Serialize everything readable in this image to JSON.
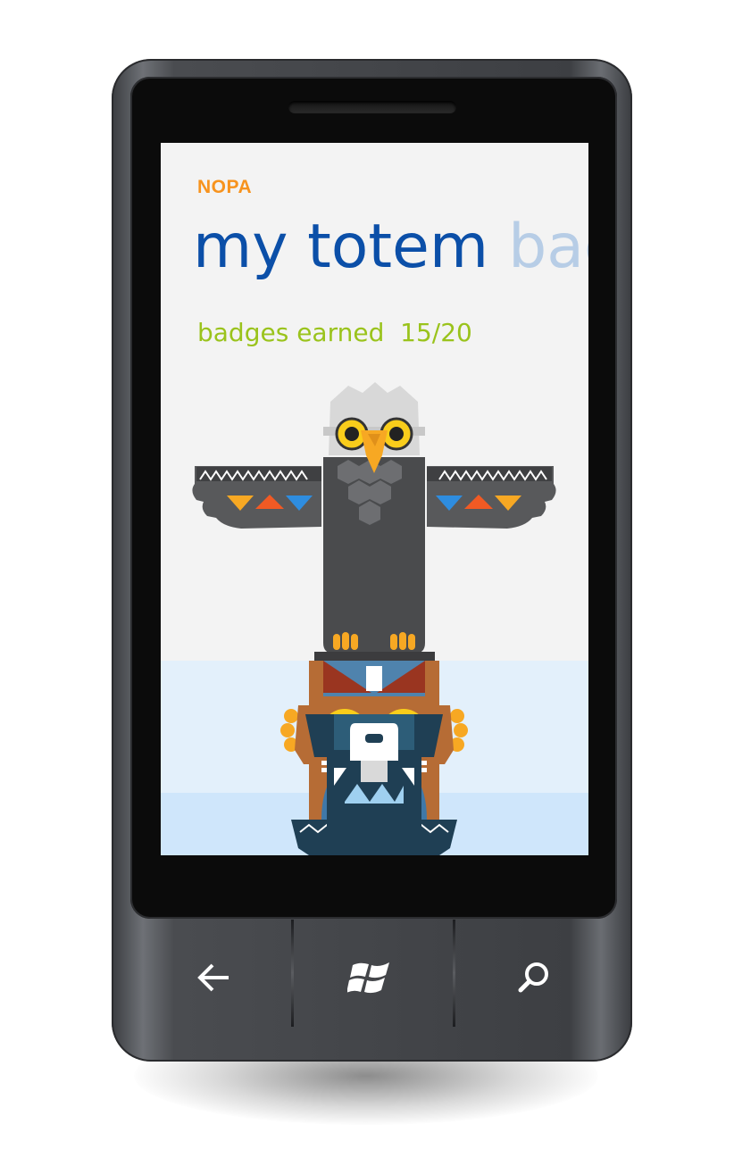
{
  "app": {
    "name": "NOPA"
  },
  "pivot": {
    "active": "my totem",
    "next": "badg"
  },
  "badges": {
    "label": "badges earned",
    "count": "15/20"
  },
  "hardware": {
    "back_icon": "back-arrow-icon",
    "start_icon": "windows-logo-icon",
    "search_icon": "search-icon"
  },
  "colors": {
    "app_name": "#f7931e",
    "pivot_active": "#0b4fa8",
    "pivot_inactive": "#b7cde6",
    "badges_text": "#9ac31c",
    "screen_bg": "#f3f3f3"
  }
}
